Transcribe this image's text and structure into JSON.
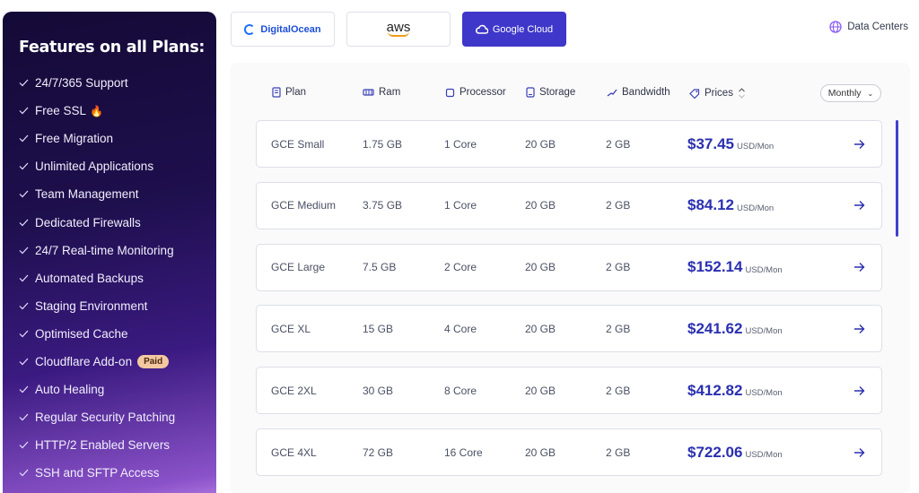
{
  "sidebar": {
    "title": "Features on all Plans:",
    "features": [
      "24/7/365 Support",
      "Free SSL",
      "Free Migration",
      "Unlimited Applications",
      "Team Management",
      "Dedicated Firewalls",
      "24/7 Real-time Monitoring",
      "Automated Backups",
      "Staging Environment",
      "Optimised Cache",
      "Cloudflare Add-on",
      "Auto Healing",
      "Regular Security Patching",
      "HTTP/2 Enabled Servers",
      "SSH and SFTP Access"
    ],
    "paid_badge": "Paid",
    "fire_glyph": "🔥"
  },
  "providers": {
    "digitalocean": "DigitalOcean",
    "aws": "aws",
    "google": "Google Cloud"
  },
  "data_centers": "Data Centers",
  "table": {
    "headers": {
      "plan": "Plan",
      "ram": "Ram",
      "processor": "Processor",
      "storage": "Storage",
      "bandwidth": "Bandwidth",
      "prices": "Prices"
    },
    "billing": "Monthly",
    "unit": "USD/Mon",
    "rows": [
      {
        "plan": "GCE Small",
        "ram": "1.75 GB",
        "cpu": "1 Core",
        "storage": "20 GB",
        "bw": "2 GB",
        "price": "$37.45"
      },
      {
        "plan": "GCE Medium",
        "ram": "3.75 GB",
        "cpu": "1 Core",
        "storage": "20 GB",
        "bw": "2 GB",
        "price": "$84.12"
      },
      {
        "plan": "GCE Large",
        "ram": "7.5 GB",
        "cpu": "2 Core",
        "storage": "20 GB",
        "bw": "2 GB",
        "price": "$152.14"
      },
      {
        "plan": "GCE XL",
        "ram": "15 GB",
        "cpu": "4 Core",
        "storage": "20 GB",
        "bw": "2 GB",
        "price": "$241.62"
      },
      {
        "plan": "GCE 2XL",
        "ram": "30 GB",
        "cpu": "8 Core",
        "storage": "20 GB",
        "bw": "2 GB",
        "price": "$412.82"
      },
      {
        "plan": "GCE 4XL",
        "ram": "72 GB",
        "cpu": "16 Core",
        "storage": "20 GB",
        "bw": "2 GB",
        "price": "$722.06"
      }
    ]
  },
  "colors": {
    "accent": "#3f37c9",
    "price": "#2a2fb0"
  }
}
